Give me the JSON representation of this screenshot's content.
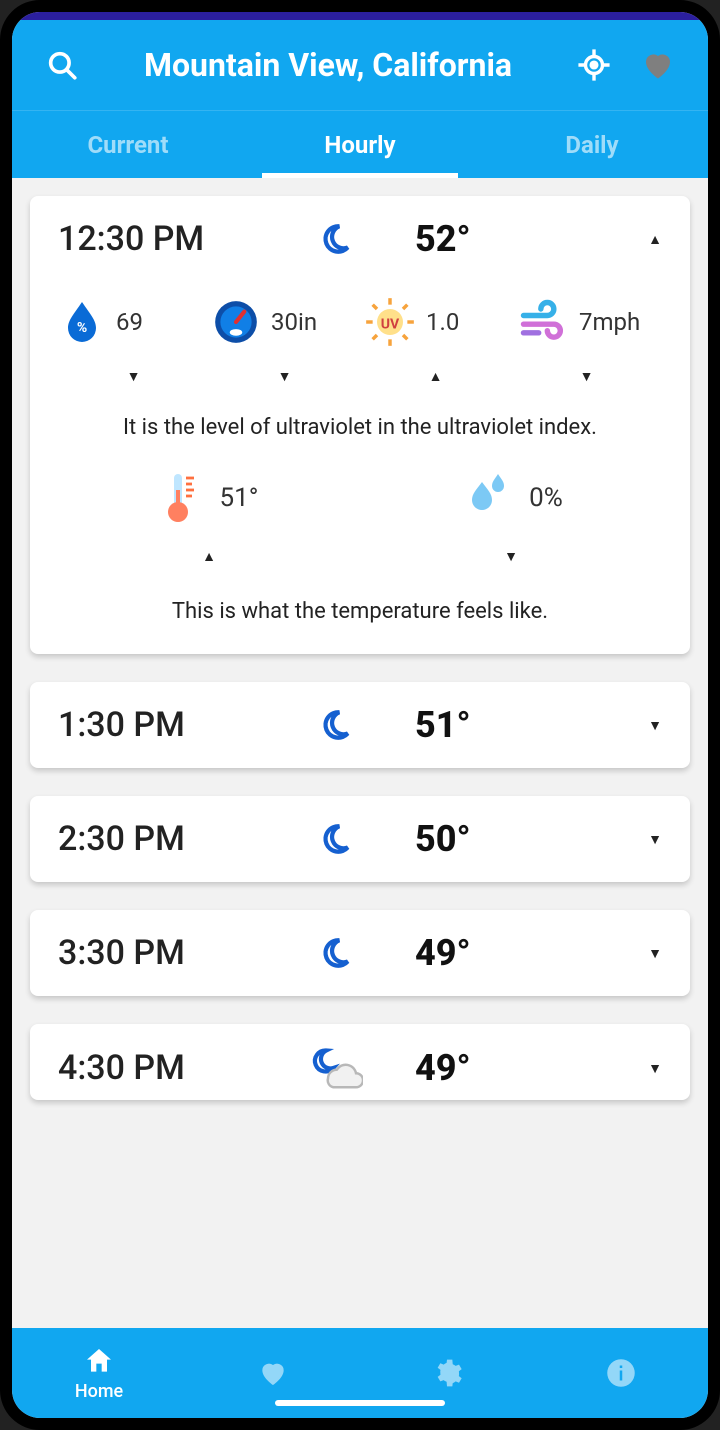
{
  "header": {
    "title": "Mountain View, California"
  },
  "tabs": [
    {
      "label": "Current",
      "active": false
    },
    {
      "label": "Hourly",
      "active": true
    },
    {
      "label": "Daily",
      "active": false
    }
  ],
  "expanded": {
    "time": "12:30 PM",
    "temp": "52°",
    "metrics": {
      "humidity": "69",
      "pressure": "30in",
      "uv": "1.0",
      "wind": "7mph"
    },
    "uv_hint": "It is the level of ultraviolet in the ultraviolet index.",
    "feelslike": "51°",
    "precip": "0%",
    "feels_hint": "This is what the temperature feels like."
  },
  "hours": [
    {
      "time": "1:30 PM",
      "temp": "51°",
      "cond": "moon"
    },
    {
      "time": "2:30 PM",
      "temp": "50°",
      "cond": "moon"
    },
    {
      "time": "3:30 PM",
      "temp": "49°",
      "cond": "moon"
    },
    {
      "time": "4:30 PM",
      "temp": "49°",
      "cond": "moon-cloud"
    }
  ],
  "bottom_nav": {
    "home": "Home"
  }
}
